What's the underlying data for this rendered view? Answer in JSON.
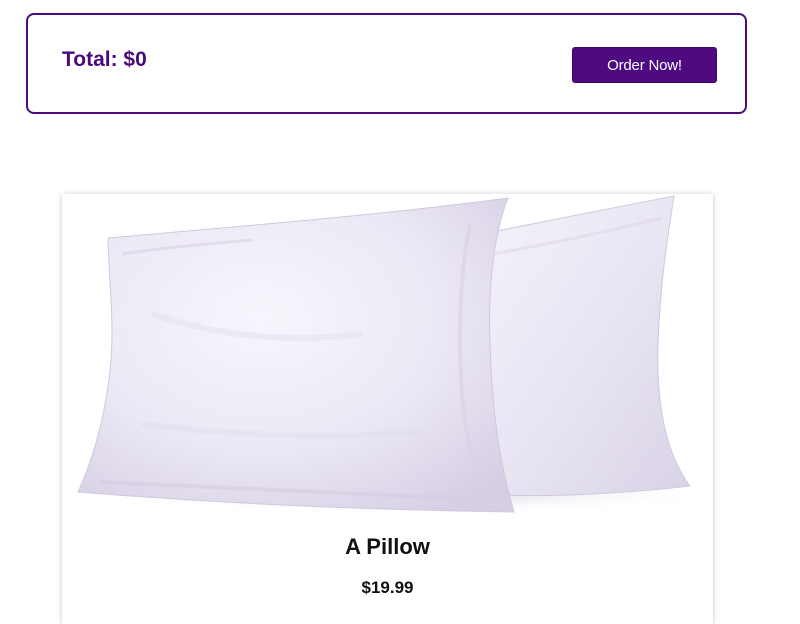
{
  "cart": {
    "total_label": "Total: $0",
    "order_button_label": "Order Now!"
  },
  "product": {
    "name": "A Pillow",
    "price": "$19.99",
    "image_icon": "pillow-image"
  },
  "colors": {
    "accent": "#4b0b7a",
    "button_bg": "#4e0a80",
    "button_text": "#ffffff",
    "text": "#111111"
  }
}
